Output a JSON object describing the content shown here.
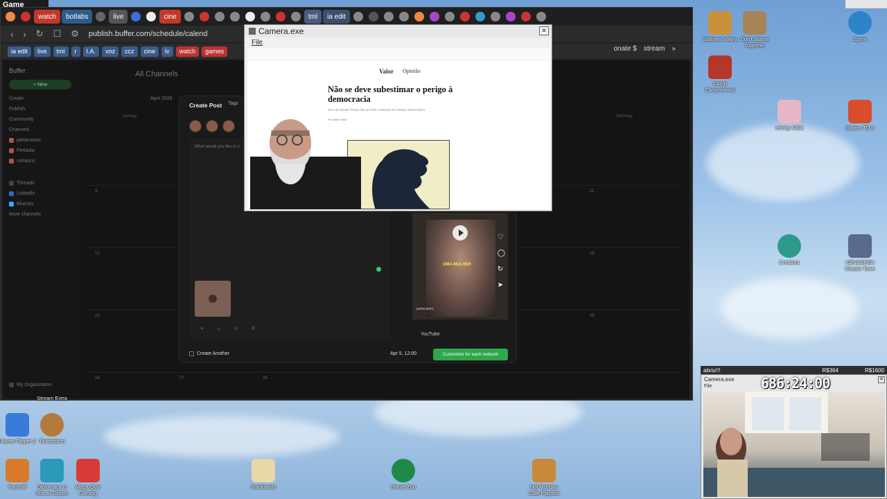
{
  "game_strip": {
    "label": "Game"
  },
  "browser": {
    "tabs": [
      {
        "label": "watch",
        "color": "#c0392b"
      },
      {
        "label": "botlabs",
        "color": "#2c5d8a"
      },
      {
        "label": "live",
        "color": "#555555"
      },
      {
        "label": "cine",
        "color": "#c0392b"
      },
      {
        "label": "tml",
        "color": "#4a5d80"
      },
      {
        "label": "ia edit",
        "color": "#3a4f6f"
      }
    ],
    "url": "publish.buffer.com/schedule/calend",
    "bookmarks": [
      {
        "label": "ia edit",
        "color": "#3b5b8c"
      },
      {
        "label": "live",
        "color": "#3b5b8c"
      },
      {
        "label": "tml",
        "color": "#3b5b8c"
      },
      {
        "label": "r",
        "color": "#3b5b8c"
      },
      {
        "label": "I.A.",
        "color": "#3b5b8c"
      },
      {
        "label": "voz",
        "color": "#3b5b8c"
      },
      {
        "label": "ccz",
        "color": "#3b5b8c"
      },
      {
        "label": "cine",
        "color": "#3b5b8c"
      },
      {
        "label": "lv",
        "color": "#3b5b8c"
      },
      {
        "label": "watch",
        "color": "#b33"
      },
      {
        "label": "games",
        "color": "#b33"
      }
    ],
    "bookmarks_right": [
      "onate $",
      "stream"
    ]
  },
  "buffer": {
    "channels_title": "All Channels",
    "month": "April 2026",
    "new_button": "+ New",
    "sidebar": [
      "Create",
      "Publish",
      "Community",
      "Channels",
      "parlacastro",
      "Perlasta",
      "cortasco",
      "Threads",
      "LinkedIn",
      "Bluesky",
      "More channels"
    ],
    "org": "My Organization",
    "days": [
      "Sunday",
      "Saturday"
    ],
    "cal_nums": [
      "5",
      "11",
      "12",
      "18",
      "19",
      "25",
      "26",
      "27",
      "28"
    ],
    "modal": {
      "title": "Create Post",
      "tags": "Tags",
      "placeholder": "What would you like to s",
      "youtube": "YouTube",
      "create_another": "Create Another",
      "date": "Apr 5, 12:00",
      "customize": "Customize for each network"
    },
    "preview": {
      "caption": "UMA MULHER",
      "user": "parlacastro"
    }
  },
  "camera": {
    "title": "Camera.exe",
    "menu": "File",
    "article": {
      "brand": "Valor",
      "section": "Opinião",
      "title": "Não se deve subestimar o perigo à democracia",
      "subtitle": "EUA de Donald Trump não um líder. Havendo em destino democrático",
      "author": "Por Martin Wolf"
    }
  },
  "desktop_icons": [
    {
      "label": "Stardew Valley",
      "color": "#c8923c"
    },
    {
      "label": "Don't Starve Together",
      "color": "#a68458"
    },
    {
      "label": "Spore",
      "color": "#2f83c8"
    },
    {
      "label": "Camp Canyonwood",
      "color": "#b53728"
    },
    {
      "label": "Infinity Nikki",
      "color": "#e8b6c6"
    },
    {
      "label": "Bloons TD 6",
      "color": "#d84d2a"
    },
    {
      "label": "Creatura",
      "color": "#2f9a8c"
    },
    {
      "label": "XENOBREA Classic Town",
      "color": "#5a6a8c"
    },
    {
      "label": "House Flipper 2",
      "color": "#3a7ad8"
    },
    {
      "label": "Timberborn",
      "color": "#b37a3a"
    },
    {
      "label": "Farmoff",
      "color": "#d87a2a"
    },
    {
      "label": "Diplomacy is Not an Option",
      "color": "#2a9ab8"
    },
    {
      "label": "Mega Quiz Gaming",
      "color": "#d83a3a"
    },
    {
      "label": "Stacklands",
      "color": "#e8d8a8"
    },
    {
      "label": "Planet Zoo",
      "color": "#1d8a4a"
    },
    {
      "label": "Not Monday Cafe Playtest",
      "color": "#c88a3a"
    },
    {
      "label": "Stream Extra",
      "color": "#888888"
    }
  ],
  "stream_panel": {
    "label": "abriu!!!",
    "amount1": "R$364",
    "amount2": "R$1600",
    "cam_title": "Camera.exe",
    "cam_file": "File",
    "counter": "686:24:00"
  }
}
